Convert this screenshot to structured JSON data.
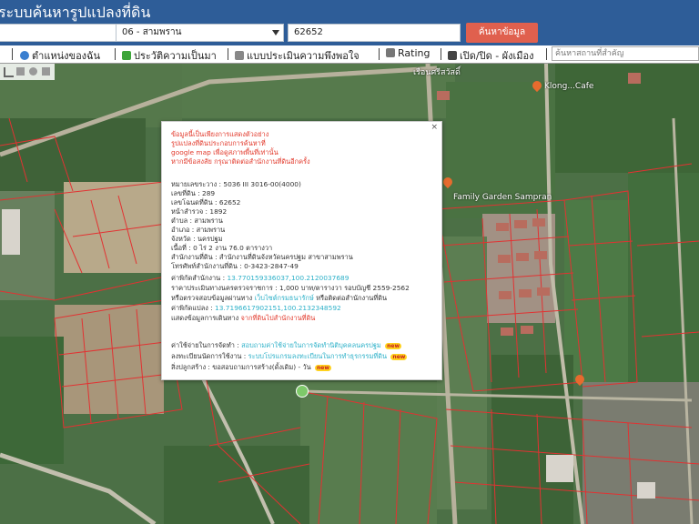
{
  "header": {
    "title": "ระบบค้นหารูปแปลงที่ดิน",
    "province_value": "",
    "district_value": "06 - สามพราน",
    "parcel_input_value": "62652",
    "search_button": "ค้นหาข้อมูล"
  },
  "nav": {
    "item1": "ตำแหน่งของฉัน",
    "item2": "ประวัติความเป็นมา",
    "item3": "แบบประเมินความพึงพอใจ",
    "item4": "Rating",
    "item5": "เปิด/ปิด - ผังเมือง",
    "place_search_placeholder": "ค้นหาสถานที่สำคัญ"
  },
  "map": {
    "poi_top": "เรือนศรีสวัสดิ์",
    "poi_right": "Klong...Cafe",
    "poi_mid": "Family Garden Sampran"
  },
  "popup": {
    "notice": [
      "ข้อมูลนี้เป็นเพียงการแสดงตัวอย่าง",
      "รูปแปลงที่ดินประกอบการค้นหาที่",
      "google map เพื่อดูสภาพพื้นที่เท่านั้น",
      "หากมีข้อสงสัย กรุณาติดต่อสำนักงานที่ดินอีกครั้ง"
    ],
    "details": [
      "หมายเลขระวาง : 5036 III 3016-00(4000)",
      "เลขที่ดิน : 289",
      "เลขโฉนดที่ดิน : 62652",
      "หน้าสำรวจ : 1892",
      "ตำบล : สามพราน",
      "อำเภอ : สามพราน",
      "จังหวัด : นครปฐม",
      "เนื้อที่ : 0 ไร่ 2 งาน 76.0 ตารางวา",
      "สำนักงานที่ดิน : สำนักงานที่ดินจังหวัดนครปฐม สาขาสามพราน",
      "โทรศัพท์สำนักงานที่ดิน : 0-3423-2847-49"
    ],
    "gps_label": "ค่าพิกัดสำนักงาน :",
    "gps_value": "13.770159336037,100.2120037689",
    "price": "ราคาประเมินทางนครตรวจราชการ : 1,000 บาท/ตารางวา รอบบัญชี 2559-2562",
    "check_prefix": "หรือตรวจสอบข้อมูลผ่านทาง",
    "check_link": "เว็บไซต์กรมธนารักษ์",
    "check_suffix": "หรือติดต่อสำนักงานที่ดิน",
    "coord_label": "ค่าพิกัดแปลง :",
    "coord_value": "13.7196617902151,100.2132348592",
    "show_label": "แสดงข้อมูลการเดินทาง",
    "show_link": "จากที่ดินไปสำนักงานที่ดิน",
    "fee_label": "ค่าใช้จ่ายในการจัดทำ :",
    "fee_link": "สอบถามค่าใช้จ่ายในการจัดทำนิติบุคคลนครปฐม",
    "appointment_label": "ลงทะเบียนนัดการใช้งาน :",
    "appointment_link": "ระบบโปรแกรมลงทะเบียนในการทำธุรกรรมที่ดิน",
    "status_label": "สิ่งปลูกสร้าง :",
    "status_value": "ขอสอบถามการสร้าง(ดั้งเดิม) - วัน",
    "new_badge": "new"
  }
}
